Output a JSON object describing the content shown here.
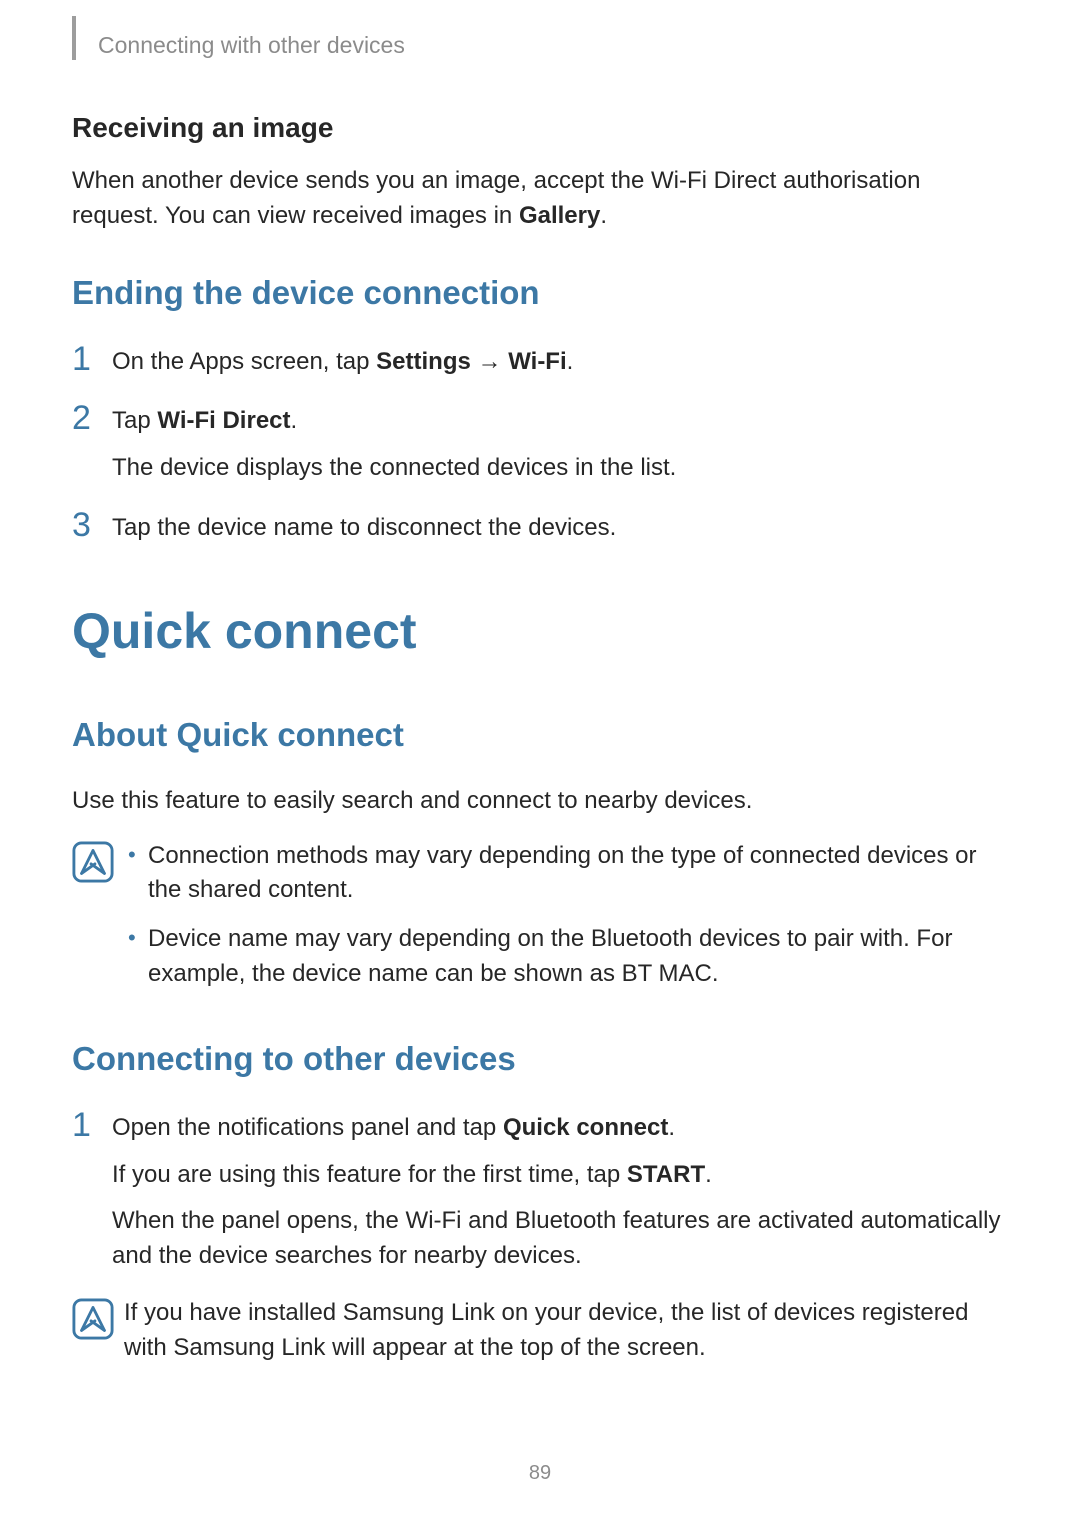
{
  "header": {
    "breadcrumb": "Connecting with other devices"
  },
  "section1": {
    "heading": "Receiving an image",
    "para_pre": "When another device sends you an image, accept the Wi-Fi Direct authorisation request. You can view received images in ",
    "para_bold": "Gallery",
    "para_post": "."
  },
  "section2": {
    "heading": "Ending the device connection",
    "steps": [
      {
        "num": "1",
        "pre": "On the Apps screen, tap ",
        "b1": "Settings",
        "mid": " → ",
        "b2": "Wi-Fi",
        "post": "."
      },
      {
        "num": "2",
        "pre": "Tap ",
        "b1": "Wi-Fi Direct",
        "post": ".",
        "extra": "The device displays the connected devices in the list."
      },
      {
        "num": "3",
        "text": "Tap the device name to disconnect the devices."
      }
    ]
  },
  "section3": {
    "heading": "Quick connect"
  },
  "section4": {
    "heading": "About Quick connect",
    "para": "Use this feature to easily search and connect to nearby devices.",
    "note_items": [
      "Connection methods may vary depending on the type of connected devices or the shared content.",
      "Device name may vary depending on the Bluetooth devices to pair with. For example, the device name can be shown as BT MAC."
    ]
  },
  "section5": {
    "heading": "Connecting to other devices",
    "steps": [
      {
        "num": "1",
        "line1_pre": "Open the notifications panel and tap ",
        "line1_b": "Quick connect",
        "line1_post": ".",
        "line2_pre": "If you are using this feature for the first time, tap ",
        "line2_b": "START",
        "line2_post": ".",
        "line3": "When the panel opens, the Wi-Fi and Bluetooth features are activated automatically and the device searches for nearby devices."
      }
    ],
    "note": "If you have installed Samsung Link on your device, the list of devices registered with Samsung Link will appear at the top of the screen."
  },
  "page_number": "89"
}
